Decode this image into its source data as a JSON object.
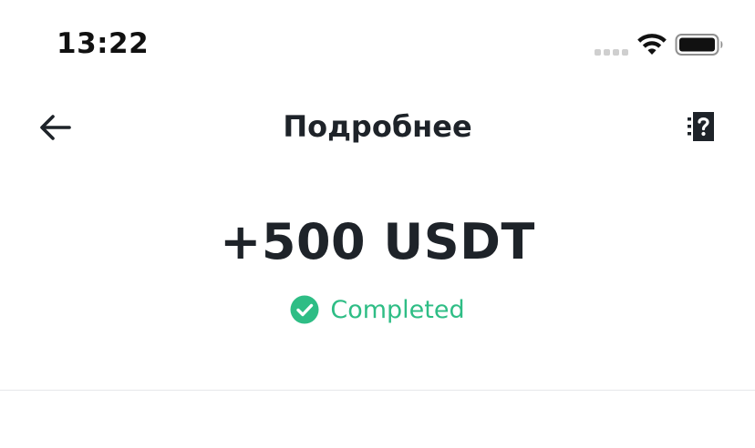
{
  "status_bar": {
    "time": "13:22",
    "icons": [
      "signal-icon",
      "wifi-icon",
      "battery-icon"
    ]
  },
  "nav": {
    "title": "Подробнее",
    "back_icon": "arrow-left-icon",
    "help_icon": "document-question-icon"
  },
  "transaction": {
    "amount": "+500 USDT",
    "status": "Completed",
    "status_icon": "check-circle-icon"
  },
  "colors": {
    "success": "#2ebd85",
    "text": "#1e2329",
    "divider": "#e6e8ea"
  }
}
